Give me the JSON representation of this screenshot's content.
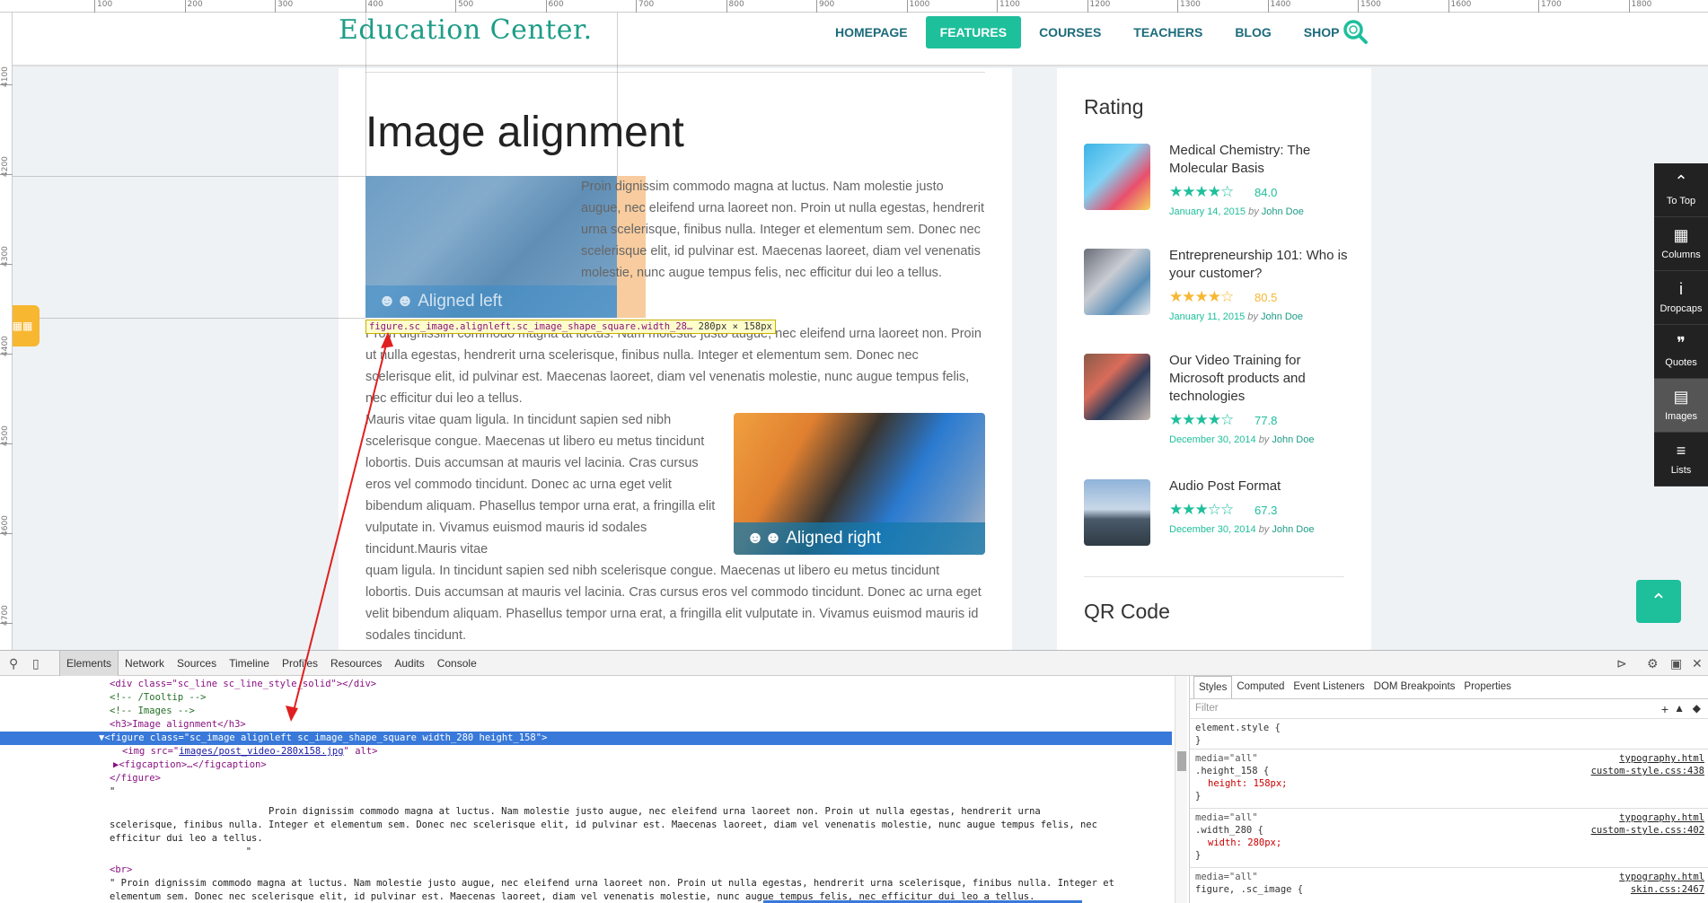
{
  "ruler": {
    "h_ticks": [
      "100",
      "200",
      "300",
      "400",
      "500",
      "600",
      "700",
      "800",
      "900",
      "1000",
      "1100",
      "1200",
      "1300",
      "1400",
      "1500",
      "1600",
      "1700",
      "1800"
    ],
    "v_ticks": [
      "4100",
      "4200",
      "4300",
      "4400",
      "4500",
      "4600",
      "4700"
    ]
  },
  "header": {
    "logo": "Education Center.",
    "nav": [
      "HOMEPAGE",
      "FEATURES",
      "COURSES",
      "TEACHERS",
      "BLOG",
      "SHOP"
    ],
    "active_nav": "FEATURES"
  },
  "content": {
    "title": "Image alignment",
    "fig_left_caption": "Aligned left",
    "fig_right_caption": "Aligned right",
    "para1": "Proin dignissim commodo magna at luctus. Nam molestie justo augue, nec eleifend urna laoreet non. Proin ut nulla egestas, hendrerit urna scelerisque, finibus nulla. Integer et elementum sem. Donec nec scelerisque elit, id pulvinar est. Maecenas laoreet, diam vel venenatis molestie, nunc augue tempus felis, nec efficitur dui leo a tellus.",
    "para2": "Proin dignissim commodo magna at luctus. Nam molestie justo augue, nec eleifend urna laoreet non. Proin ut nulla egestas, hendrerit urna scelerisque, finibus nulla. Integer et elementum sem. Donec nec scelerisque elit, id pulvinar est. Maecenas laoreet, diam vel venenatis molestie, nunc augue tempus felis, nec efficitur dui leo a tellus.",
    "para3": "Mauris vitae quam ligula. In tincidunt sapien sed nibh scelerisque congue. Maecenas ut libero eu metus tincidunt lobortis. Duis accumsan at mauris vel lacinia. Cras cursus eros vel commodo tincidunt. Donec ac urna eget velit bibendum aliquam. Phasellus tempor urna erat, a fringilla elit vulputate in. Vivamus euismod mauris id sodales tincidunt.Mauris vitae",
    "para4": "quam ligula. In tincidunt sapien sed nibh scelerisque congue. Maecenas ut libero eu metus tincidunt lobortis. Duis accumsan at mauris vel lacinia. Cras cursus eros vel commodo tincidunt. Donec ac urna eget velit bibendum aliquam. Phasellus tempor urna erat, a fringilla elit vulputate in. Vivamus euismod mauris id sodales tincidunt."
  },
  "tooltip": {
    "selector": "figure.sc_image.alignleft.sc_image_shape_square.width_28…",
    "w": "280",
    "h": "158",
    "unit": "px",
    "x": "×"
  },
  "sidebar": {
    "rating_title": "Rating",
    "qr_title": "QR Code",
    "items": [
      {
        "title": "Medical Chemistry: The Molecular Basis",
        "stars": "★★★★☆",
        "score": "84.0",
        "date": "January 14, 2015",
        "by": "by",
        "author": "John Doe",
        "color": "#1ebf9b",
        "rating": 4.2
      },
      {
        "title": "Entrepreneurship 101: Who is your customer?",
        "stars": "★★★★☆",
        "score": "80.5",
        "date": "January 11, 2015",
        "by": "by",
        "author": "John Doe",
        "color": "#f7b731",
        "rating": 4.0
      },
      {
        "title": "Our Video Training for Microsoft products and technologies",
        "stars": "★★★★☆",
        "score": "77.8",
        "date": "December 30, 2014",
        "by": "by",
        "author": "John Doe",
        "color": "#1ebf9b",
        "rating": 3.9
      },
      {
        "title": "Audio Post Format",
        "stars": "★★★☆☆",
        "score": "67.3",
        "date": "December 30, 2014",
        "by": "by",
        "author": "John Doe",
        "color": "#1ebf9b",
        "rating": 3.4
      }
    ]
  },
  "tools": [
    {
      "icon": "⌃",
      "label": "To Top"
    },
    {
      "icon": "▦",
      "label": "Columns"
    },
    {
      "icon": "i",
      "label": "Dropcaps"
    },
    {
      "icon": "❞",
      "label": "Quotes"
    },
    {
      "icon": "▤",
      "label": "Images"
    },
    {
      "icon": "≡",
      "label": "Lists"
    }
  ],
  "devtools": {
    "tabs": [
      "Elements",
      "Network",
      "Sources",
      "Timeline",
      "Profiles",
      "Resources",
      "Audits",
      "Console"
    ],
    "active_tab": "Elements",
    "dom": {
      "l1a": "<div class=\"sc_line sc_line_style_solid\"></div>",
      "l2": "<!-- /Tooltip -->",
      "l3": "<!-- Images -->",
      "l4": "<h3>Image alignment</h3>",
      "l5": "▼<figure class=\"sc_image alignleft sc_image_shape_square width_280 height_158\">",
      "l6a": "<img src=\"",
      "l6b": "images/post_video-280x158.jpg",
      "l6c": "\" alt>",
      "l7": "▶<figcaption>…</figcaption>",
      "l8": "</figure>",
      "l9": "\"",
      "l10": "                            Proin dignissim commodo magna at luctus. Nam molestie justo augue, nec eleifend urna laoreet non. Proin ut nulla egestas, hendrerit urna",
      "l11": "scelerisque, finibus nulla. Integer et elementum sem. Donec nec scelerisque elit, id pulvinar est. Maecenas laoreet, diam vel venenatis molestie, nunc augue tempus felis, nec",
      "l12": "efficitur dui leo a tellus.",
      "l13": "                        \"",
      "l14": "<br>",
      "l15": "\" Proin dignissim commodo magna at luctus. Nam molestie justo augue, nec eleifend urna laoreet non. Proin ut nulla egestas, hendrerit urna scelerisque, finibus nulla. Integer et",
      "l16": "elementum sem. Donec nec scelerisque elit, id pulvinar est. Maecenas laoreet, diam vel venenatis molestie, nunc augue tempus felis, nec efficitur dui leo a tellus.",
      "l17": "                        \""
    },
    "styles_tabs": [
      "Styles",
      "Computed",
      "Event Listeners",
      "DOM Breakpoints",
      "Properties"
    ],
    "filter_placeholder": "Filter",
    "rules": [
      {
        "media": "",
        "selector": "element.style {",
        "prop": "",
        "close": "}",
        "src1": "",
        "src2": ""
      },
      {
        "media": "media=\"all\"",
        "selector": ".height_158 {",
        "prop": "height: 158px;",
        "close": "}",
        "src1": "typography.html",
        "src2": "custom-style.css:438"
      },
      {
        "media": "media=\"all\"",
        "selector": ".width_280 {",
        "prop": "width: 280px;",
        "close": "}",
        "src1": "typography.html",
        "src2": "custom-style.css:402"
      },
      {
        "media": "media=\"all\"",
        "selector": "figure, .sc_image {",
        "prop": "",
        "close": "",
        "src1": "typography.html",
        "src2": "skin.css:2467"
      }
    ]
  }
}
